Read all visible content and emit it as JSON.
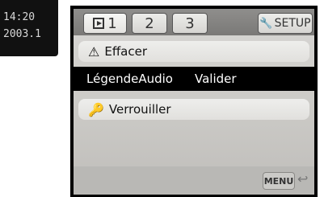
{
  "thumbnail": {
    "time": "14:20",
    "date": "2003.1"
  },
  "tabs": [
    {
      "label": "1"
    },
    {
      "label": "2"
    },
    {
      "label": "3"
    }
  ],
  "setup_label": "SETUP",
  "menu": {
    "items": [
      {
        "label": "Effacer",
        "icon": "warning-icon"
      },
      {
        "label": "LégendeAudio",
        "value": "Valider"
      },
      {
        "label": "Verrouiller",
        "icon": "key-icon"
      }
    ]
  },
  "footer": {
    "menu_label": "MENU",
    "return_icon": "return-icon"
  }
}
